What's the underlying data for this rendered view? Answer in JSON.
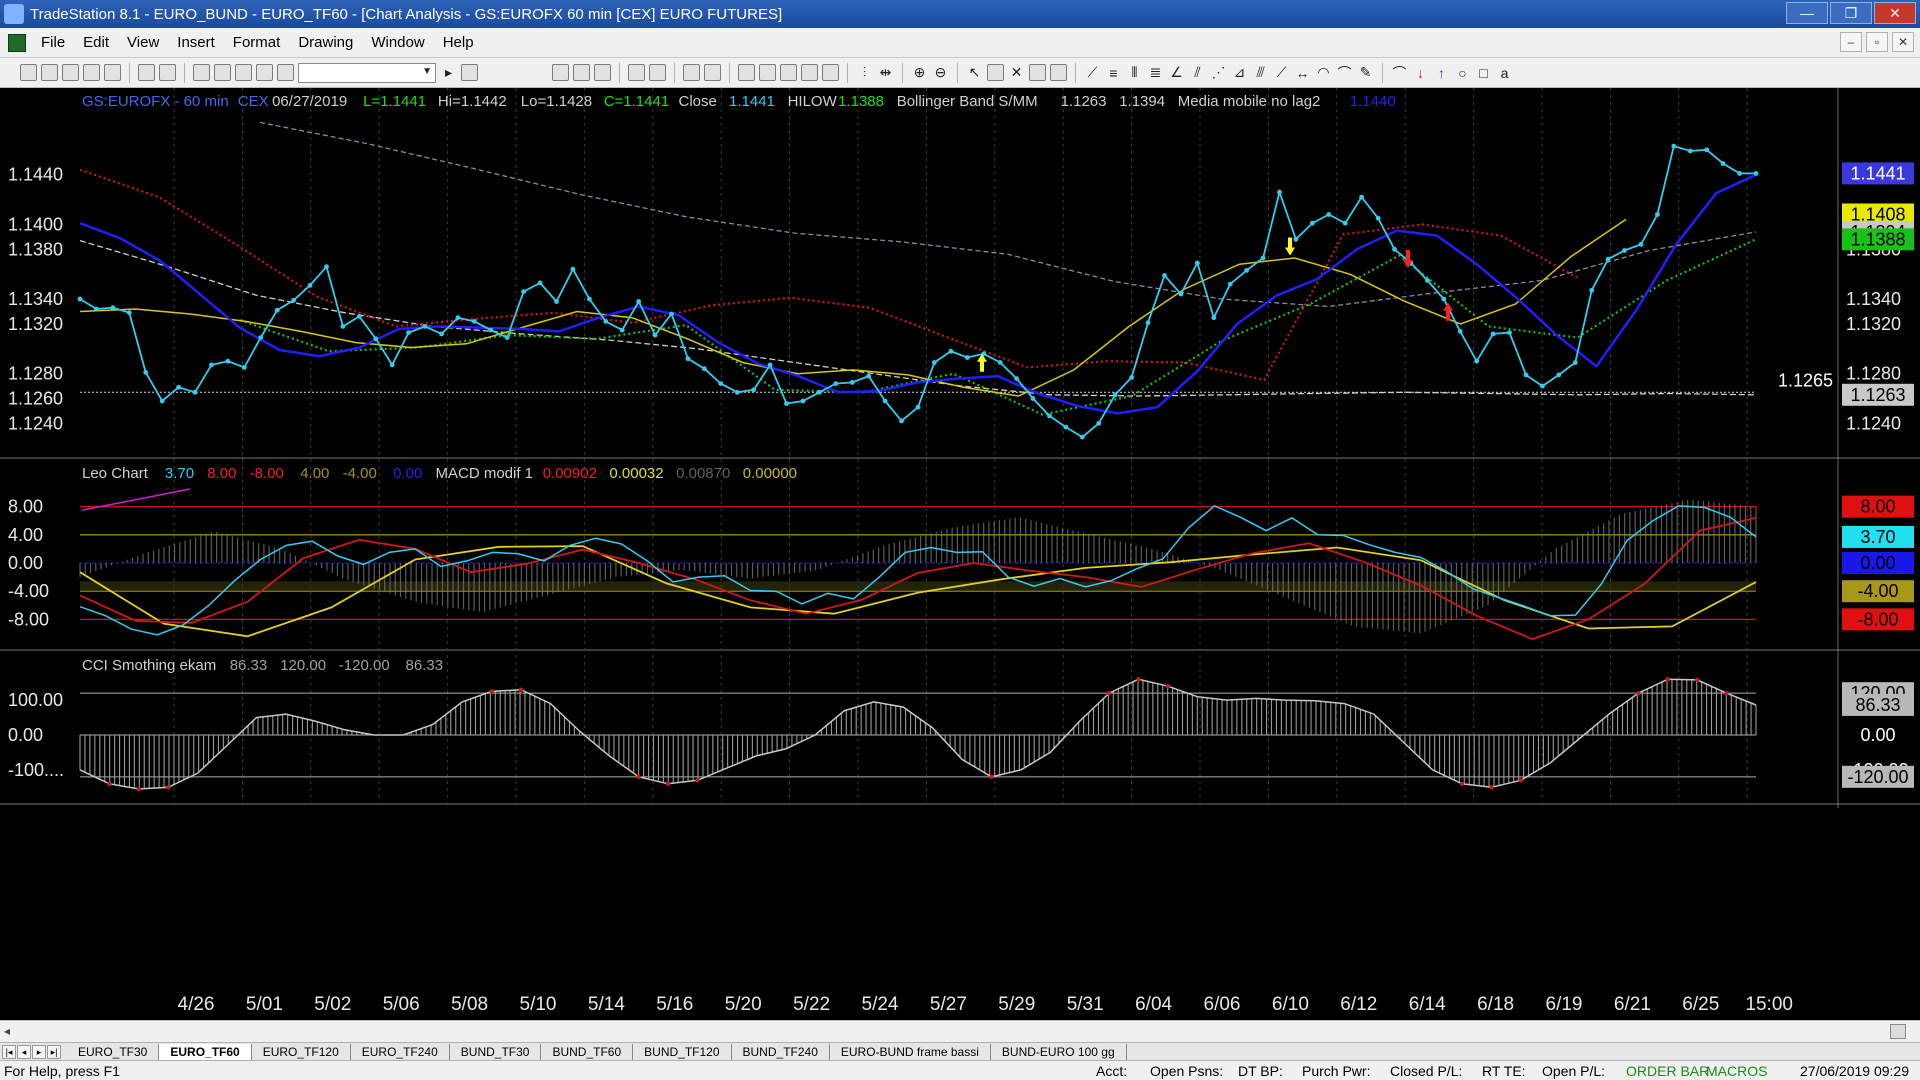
{
  "window": {
    "title": "TradeStation 8.1 - EURO_BUND - EURO_TF60 - [Chart Analysis - GS:EUROFX  60 min  [CEX] EURO FUTURES]",
    "minimize": "—",
    "maximize": "❐",
    "close": "✕"
  },
  "menu": [
    "File",
    "Edit",
    "View",
    "Insert",
    "Format",
    "Drawing",
    "Window",
    "Help"
  ],
  "mdi_buttons": [
    "–",
    "▫",
    "✕"
  ],
  "status": {
    "help": "For Help, press F1",
    "acct": "Acct:",
    "open_psns": "Open Psns:",
    "dt_bp": "DT BP:",
    "purch_pwr": "Purch Pwr:",
    "closed_pl": "Closed P/L:",
    "rt_te": "RT TE:",
    "open_pl": "Open P/L:",
    "order_bar": "ORDER BAR",
    "macros": "MACROS",
    "datetime": "27/06/2019 09:29"
  },
  "tabs": [
    "EURO_TF30",
    "EURO_TF60",
    "EURO_TF120",
    "EURO_TF240",
    "BUND_TF30",
    "BUND_TF60",
    "BUND_TF120",
    "BUND_TF240",
    "EURO-BUND frame bassi",
    "BUND-EURO 100 gg"
  ],
  "active_tab": "EURO_TF60",
  "colors": {
    "price": "#33ccee",
    "ma_blue": "#1f1fff",
    "ma_yellow": "#d6c814",
    "ma_white": "#cfcfcf",
    "dots_red": "#d11818",
    "dots_green": "#18c018",
    "macd_red": "#d11818",
    "macd_yellow": "#e0d020",
    "hist_gray": "#7a7a7a",
    "cci_gray": "#9a9a9a"
  },
  "chart_data": [
    {
      "panel": "price",
      "type": "line",
      "header": [
        {
          "text": "GS:EUROFX - 60 min",
          "color": "#4466ee"
        },
        {
          "text": "CEX",
          "color": "#4466ee"
        },
        {
          "text": "06/27/2019",
          "color": "#d0d0d0"
        },
        {
          "text": "L=1.1441",
          "color": "#22dd22"
        },
        {
          "text": "Hi=1.1442",
          "color": "#d0d0d0"
        },
        {
          "text": "Lo=1.1428",
          "color": "#d0d0d0"
        },
        {
          "text": "C=1.1441",
          "color": "#22dd22"
        },
        {
          "text": "Close",
          "color": "#d0d0d0"
        },
        {
          "text": "1.1441",
          "color": "#33ccee"
        },
        {
          "text": "HILOW",
          "color": "#d0d0d0"
        },
        {
          "text": "1.1388",
          "color": "#22dd22"
        },
        {
          "text": "Bollinger Band S/MM",
          "color": "#d0d0d0"
        },
        {
          "text": "1.1263",
          "color": "#d0d0d0"
        },
        {
          "text": "1.1394",
          "color": "#d0d0d0"
        },
        {
          "text": "Media mobile no lag2",
          "color": "#d0d0d0"
        },
        {
          "text": "1.1440",
          "color": "#2222ff"
        }
      ],
      "y_ticks": [
        "1.1440",
        "1.1400",
        "1.1380",
        "1.1340",
        "1.1320",
        "1.1280",
        "1.1260",
        "1.1240"
      ],
      "y_tick_values": [
        1.144,
        1.14,
        1.138,
        1.134,
        1.132,
        1.128,
        1.126,
        1.124
      ],
      "ylim": [
        1.1217,
        1.1492
      ],
      "right_y_ticks": [
        "1.1440",
        "1.1380",
        "1.1340",
        "1.1320",
        "1.1280",
        "1.1240"
      ],
      "badges": [
        {
          "text": "1.1441",
          "value": 1.1441,
          "bg": "#3a3adc",
          "fg": "#ffffff"
        },
        {
          "text": "1.1408",
          "value": 1.1408,
          "bg": "#e8e800",
          "fg": "#000000"
        },
        {
          "text": "1.1394",
          "value": 1.1394,
          "bg": "#c8c8c8",
          "fg": "#000000"
        },
        {
          "text": "1.1388",
          "value": 1.1388,
          "bg": "#18c018",
          "fg": "#000000"
        },
        {
          "text": "1.1263",
          "value": 1.1263,
          "bg": "#c8c8c8",
          "fg": "#000000"
        }
      ],
      "hline": {
        "text": "1.1265",
        "value": 1.1265
      },
      "close": [
        1.134,
        1.1332,
        1.1333,
        1.1329,
        1.1281,
        1.1258,
        1.1269,
        1.1265,
        1.1287,
        1.129,
        1.1285,
        1.1309,
        1.1331,
        1.1339,
        1.1351,
        1.1366,
        1.1318,
        1.1326,
        1.1308,
        1.1287,
        1.1313,
        1.1318,
        1.1312,
        1.1325,
        1.1322,
        1.1315,
        1.1309,
        1.1346,
        1.1353,
        1.1338,
        1.1364,
        1.134,
        1.1322,
        1.1315,
        1.1338,
        1.1311,
        1.1328,
        1.1292,
        1.1284,
        1.1272,
        1.1265,
        1.1267,
        1.1287,
        1.1256,
        1.1258,
        1.1265,
        1.1272,
        1.1273,
        1.1278,
        1.1258,
        1.1242,
        1.1253,
        1.1289,
        1.1298,
        1.1293,
        1.1296,
        1.1289,
        1.1276,
        1.126,
        1.1246,
        1.1237,
        1.1229,
        1.124,
        1.1263,
        1.1277,
        1.1321,
        1.1359,
        1.1344,
        1.1369,
        1.1325,
        1.1352,
        1.1363,
        1.1373,
        1.1426,
        1.1388,
        1.1401,
        1.1408,
        1.1401,
        1.1422,
        1.1405,
        1.138,
        1.1369,
        1.1355,
        1.134,
        1.1314,
        1.129,
        1.1312,
        1.1313,
        1.1279,
        1.127,
        1.1279,
        1.1289,
        1.1347,
        1.1372,
        1.1379,
        1.1384,
        1.1408,
        1.1463,
        1.1459,
        1.146,
        1.1449,
        1.1441,
        1.1441
      ],
      "ma_blue": [
        1.1401,
        1.1389,
        1.1371,
        1.1344,
        1.1317,
        1.1299,
        1.1294,
        1.1301,
        1.1316,
        1.1318,
        1.1317,
        1.1316,
        1.1314,
        1.1325,
        1.1334,
        1.1327,
        1.1305,
        1.1288,
        1.1278,
        1.1265,
        1.1266,
        1.1273,
        1.1276,
        1.1278,
        1.1264,
        1.1254,
        1.1248,
        1.1253,
        1.1282,
        1.132,
        1.1343,
        1.1356,
        1.138,
        1.1395,
        1.1391,
        1.1368,
        1.1341,
        1.1311,
        1.1286,
        1.1331,
        1.1384,
        1.1425,
        1.144
      ],
      "ma_yellow": [
        1.133,
        1.1332,
        1.1328,
        1.1322,
        1.1314,
        1.1305,
        1.1301,
        1.1304,
        1.1317,
        1.133,
        1.1325,
        1.1308,
        1.1289,
        1.128,
        1.1283,
        1.1279,
        1.1269,
        1.1262,
        1.1283,
        1.1318,
        1.1348,
        1.1368,
        1.1373,
        1.136,
        1.1338,
        1.132,
        1.1336,
        1.1374,
        1.1404
      ],
      "ma_white": [
        1.1387,
        1.1366,
        1.1343,
        1.1329,
        1.1318,
        1.1312,
        1.1307,
        1.13,
        1.129,
        1.128,
        1.127,
        1.1263,
        1.1262,
        1.1263,
        1.1264,
        1.1265,
        1.1264,
        1.1263,
        1.1264,
        1.1263
      ],
      "ma_gray": [
        1.1482,
        1.1465,
        1.1445,
        1.1424,
        1.1406,
        1.1393,
        1.1386,
        1.1376,
        1.1354,
        1.134,
        1.1334,
        1.1345,
        1.1355,
        1.1379,
        1.1394
      ],
      "dots_red": [
        1.1444,
        1.1422,
        1.1383,
        1.1342,
        1.1318,
        1.1324,
        1.1329,
        1.1321,
        1.1335,
        1.1341,
        1.1333,
        1.1309,
        1.1285,
        1.129,
        1.1289,
        1.1275,
        1.1392,
        1.14,
        1.1391,
        1.1356
      ],
      "dots_green": [
        1.1323,
        1.1298,
        1.1301,
        1.1311,
        1.1308,
        1.1319,
        1.1267,
        1.1265,
        1.128,
        1.1247,
        1.1262,
        1.1306,
        1.1336,
        1.1375,
        1.1318,
        1.1309,
        1.1355,
        1.1388
      ],
      "x_labels": [
        "4/26",
        "5/01",
        "5/02",
        "5/06",
        "5/08",
        "5/10",
        "5/14",
        "5/16",
        "5/20",
        "5/22",
        "5/24",
        "5/27",
        "5/29",
        "5/31",
        "6/04",
        "6/06",
        "6/10",
        "6/12",
        "6/14",
        "6/18",
        "6/19",
        "6/21",
        "6/25",
        "15:00"
      ]
    },
    {
      "panel": "leo-macd",
      "type": "line",
      "header": [
        {
          "text": "Leo Chart",
          "color": "#d0d0d0"
        },
        {
          "text": "3.70",
          "color": "#33ccee"
        },
        {
          "text": "8.00",
          "color": "#ee2222"
        },
        {
          "text": "-8.00",
          "color": "#ee2222"
        },
        {
          "text": "4.00",
          "color": "#a09020"
        },
        {
          "text": "-4.00",
          "color": "#a09020"
        },
        {
          "text": "0.00",
          "color": "#2222ee"
        },
        {
          "text": "MACD modif 1",
          "color": "#d0d0d0"
        },
        {
          "text": "0.00902",
          "color": "#ee2222"
        },
        {
          "text": "0.00032",
          "color": "#e0e020"
        },
        {
          "text": "0.00870",
          "color": "#606060"
        },
        {
          "text": "0.00000",
          "color": "#c8b820"
        }
      ],
      "y_ticks": [
        "8.00",
        "4.00",
        "0.00",
        "-4.00",
        "-8.00"
      ],
      "y_tick_values": [
        8,
        4,
        0,
        -4,
        -8
      ],
      "ylim": [
        -11.5,
        11.5
      ],
      "badges": [
        {
          "text": "8.00",
          "value": 8,
          "bg": "#e01010",
          "fg": "#000000"
        },
        {
          "text": "3.70",
          "value": 3.7,
          "bg": "#20e0f0",
          "fg": "#000000"
        },
        {
          "text": "0.00",
          "value": 0,
          "bg": "#1818e8",
          "fg": "#000000"
        },
        {
          "text": "-4.00",
          "value": -4,
          "bg": "#a89818",
          "fg": "#000000"
        },
        {
          "text": "-8.00",
          "value": -8,
          "bg": "#e01010",
          "fg": "#000000"
        }
      ],
      "leo": [
        -6.2,
        -7.5,
        -9.4,
        -10.2,
        -8.8,
        -6.0,
        -2.5,
        0.5,
        2.5,
        3.1,
        1.0,
        -0.2,
        1.5,
        2.0,
        -0.5,
        0.3,
        1.5,
        1.3,
        0.3,
        2.5,
        3.5,
        2.7,
        0.3,
        -2.7,
        -2.0,
        -1.8,
        -3.9,
        -4.0,
        -5.8,
        -4.3,
        -5.1,
        -2.0,
        1.5,
        2.2,
        1.5,
        1.6,
        -2.0,
        -3.3,
        -2.2,
        -3.4,
        -2.5,
        -0.8,
        0.6,
        5.0,
        8.1,
        6.5,
        4.6,
        6.4,
        4.0,
        3.9,
        2.6,
        1.5,
        0.8,
        -1.2,
        -3.6,
        -4.9,
        -6.1,
        -7.5,
        -7.4,
        -3.0,
        3.2,
        6.0,
        8.1,
        7.9,
        6.5,
        3.7
      ],
      "macd_red": [
        -4.6,
        -8.2,
        -8.5,
        -5.5,
        0.7,
        3.3,
        2.0,
        -1.3,
        -0.1,
        1.9,
        0.0,
        -2.3,
        -5.3,
        -7.2,
        -5.2,
        -1.4,
        0.0,
        -1.1,
        -2.0,
        -3.4,
        -0.9,
        1.4,
        2.8,
        0.1,
        -3.2,
        -7.5,
        -10.8,
        -8.0,
        -3.0,
        4.6,
        6.4
      ],
      "macd_yellow": [
        -1.3,
        -8.6,
        -10.4,
        -6.3,
        0.5,
        2.3,
        2.4,
        -2.9,
        -6.3,
        -7.2,
        -4.2,
        -2.3,
        -0.7,
        0.1,
        1.2,
        2.2,
        0.4,
        -5.3,
        -9.3,
        -9.0,
        -2.7
      ],
      "macd_hist": [
        -2.0,
        1.5,
        4.5,
        2.0,
        -2.5,
        -5.5,
        -7.0,
        -4.5,
        -2.0,
        -1.0,
        -2.2,
        -1.0,
        2.5,
        5.0,
        6.5,
        4.2,
        2.0,
        -1.0,
        -5.0,
        -9.0,
        -10.0,
        -6.0,
        2.0,
        7.0,
        9.0,
        8.0
      ]
    },
    {
      "panel": "cci",
      "type": "bar",
      "header": [
        {
          "text": "CCI Smothing ekam",
          "color": "#d0d0d0"
        },
        {
          "text": "86.33",
          "color": "#a0a0a0"
        },
        {
          "text": "120.00",
          "color": "#a0a0a0"
        },
        {
          "text": "-120.00",
          "color": "#a0a0a0"
        },
        {
          "text": "86.33",
          "color": "#a0a0a0"
        }
      ],
      "y_ticks": [
        "100.00",
        "0.00",
        "-100...."
      ],
      "y_tick_values": [
        100,
        0,
        -100
      ],
      "ylim": [
        -175,
        175
      ],
      "badges": [
        {
          "text": "120.00",
          "value": 120,
          "bg": "#b8b8b8",
          "fg": "#000000"
        },
        {
          "text": "86.33",
          "value": 86.33,
          "bg": "#b8b8b8",
          "fg": "#000000"
        },
        {
          "text": "0.00",
          "value": 0,
          "bg": "#000000",
          "fg": "#ffffff"
        },
        {
          "text": "-100.00",
          "value": -100,
          "bg": "#000000",
          "fg": "#ffffff"
        },
        {
          "text": "-120.00",
          "value": -120,
          "bg": "#b8b8b8",
          "fg": "#000000"
        }
      ],
      "values": [
        -100,
        -140,
        -155,
        -150,
        -110,
        -30,
        50,
        60,
        40,
        15,
        0,
        0,
        30,
        95,
        125,
        130,
        90,
        10,
        -60,
        -120,
        -140,
        -130,
        -95,
        -60,
        -40,
        0,
        70,
        95,
        80,
        20,
        -70,
        -120,
        -100,
        -50,
        40,
        120,
        160,
        140,
        110,
        100,
        105,
        100,
        98,
        90,
        60,
        -20,
        -100,
        -140,
        -150,
        -130,
        -80,
        -10,
        60,
        120,
        160,
        158,
        120,
        86
      ]
    }
  ]
}
